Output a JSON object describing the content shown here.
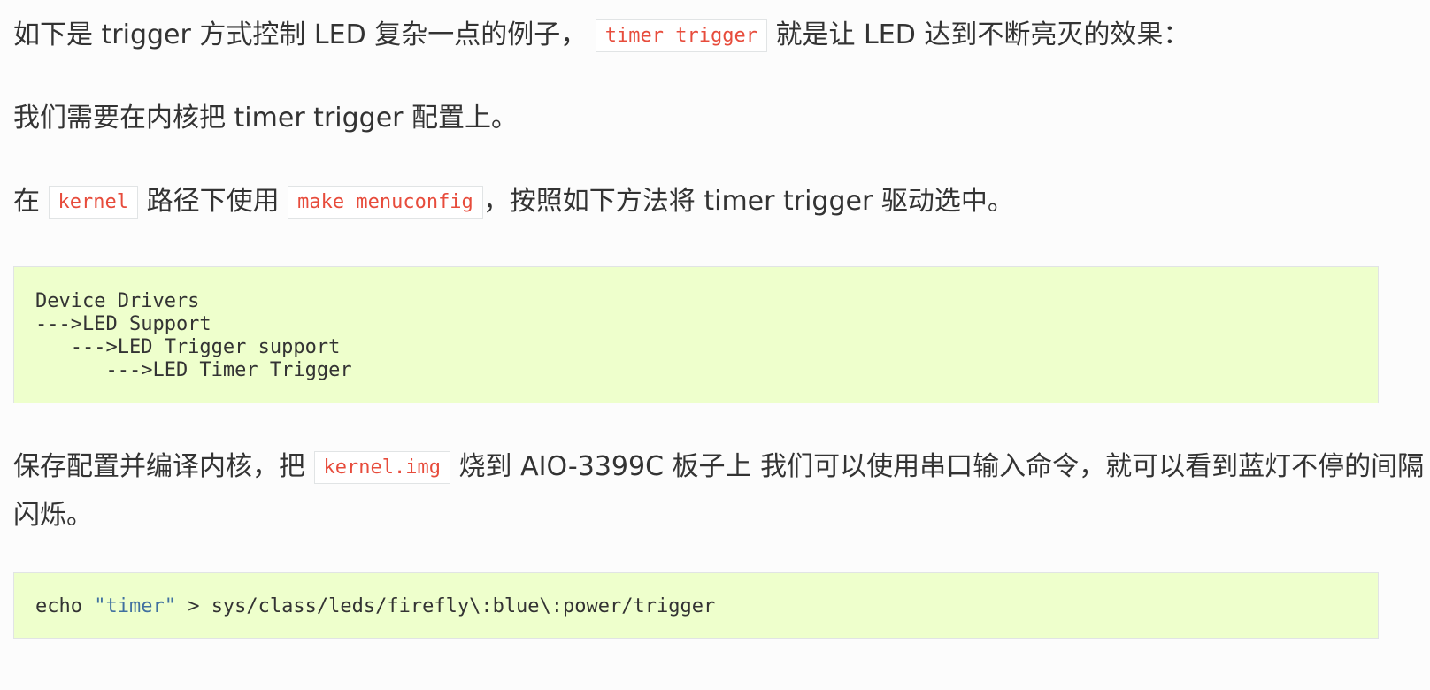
{
  "paragraphs": {
    "p1": {
      "before": "如下是 trigger 方式控制 LED 复杂一点的例子，",
      "code": "timer trigger",
      "after": "就是让 LED 达到不断亮灭的效果："
    },
    "p2": {
      "text": "我们需要在内核把 timer trigger 配置上。"
    },
    "p3": {
      "t1": "在",
      "code1": "kernel",
      "t2": "路径下使用",
      "code2": "make menuconfig",
      "t3": "，按照如下方法将 timer trigger 驱动选中。"
    },
    "p4": {
      "before": "保存配置并编译内核，把",
      "code": "kernel.img",
      "after": "烧到 AIO-3399C 板子上 我们可以使用串口输入命令，就可以看到蓝灯不停的间隔闪烁。"
    }
  },
  "menu_block": {
    "lines": [
      "Device Drivers",
      "--->LED Support",
      "   --->LED Trigger support",
      "      --->LED Timer Trigger"
    ]
  },
  "command_block": {
    "cmd": "echo ",
    "arg": "\"timer\"",
    "rest": " > sys/class/leds/firefly\\:blue\\:power/trigger"
  }
}
